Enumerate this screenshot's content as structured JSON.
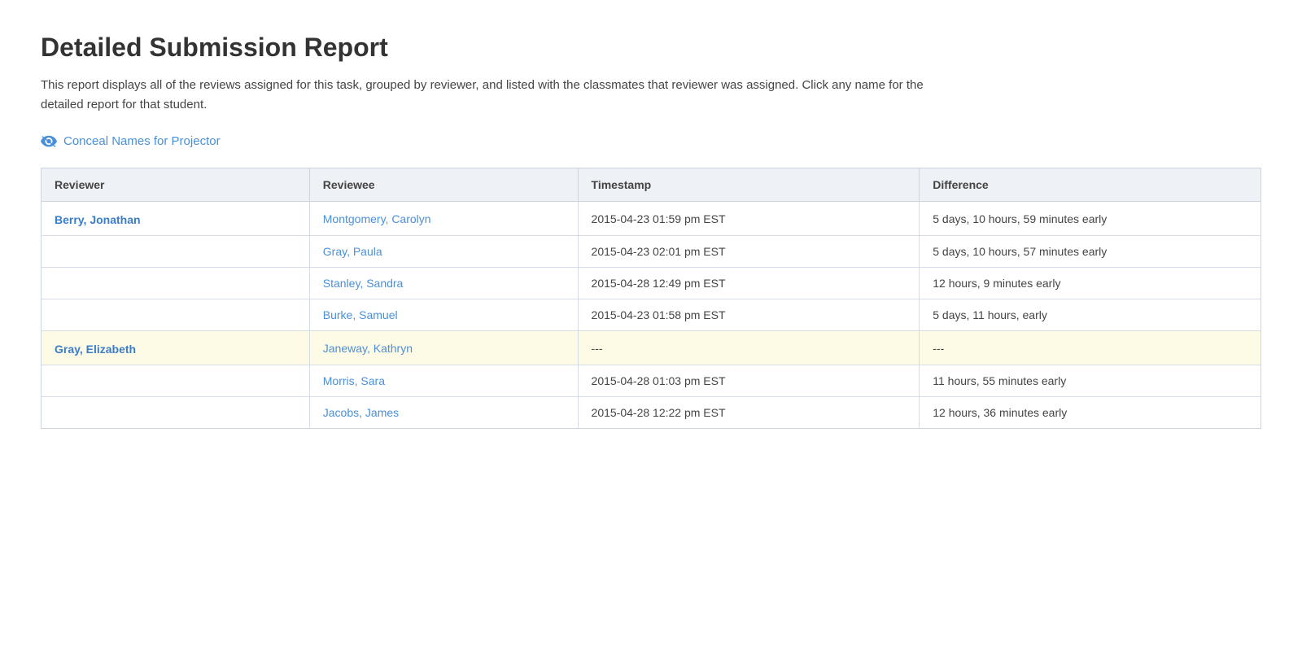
{
  "page": {
    "title": "Detailed Submission Report",
    "description": "This report displays all of the reviews assigned for this task, grouped by reviewer, and listed with the classmates that reviewer was assigned. Click any name for the detailed report for that student.",
    "conceal_label": "Conceal Names for Projector"
  },
  "table": {
    "headers": [
      "Reviewer",
      "Reviewee",
      "Timestamp",
      "Difference"
    ],
    "rows": [
      {
        "reviewer": "Berry, Jonathan",
        "reviewee": "Montgomery, Carolyn",
        "timestamp": "2015-04-23 01:59 pm EST",
        "difference": "5 days, 10 hours, 59 minutes early",
        "highlight": false
      },
      {
        "reviewer": "",
        "reviewee": "Gray, Paula",
        "timestamp": "2015-04-23 02:01 pm EST",
        "difference": "5 days, 10 hours, 57 minutes early",
        "highlight": false
      },
      {
        "reviewer": "",
        "reviewee": "Stanley, Sandra",
        "timestamp": "2015-04-28 12:49 pm EST",
        "difference": "12 hours, 9 minutes early",
        "highlight": false
      },
      {
        "reviewer": "",
        "reviewee": "Burke, Samuel",
        "timestamp": "2015-04-23 01:58 pm EST",
        "difference": "5 days, 11 hours, early",
        "highlight": false
      },
      {
        "reviewer": "Gray, Elizabeth",
        "reviewee": "Janeway, Kathryn",
        "timestamp": "---",
        "difference": "---",
        "highlight": true
      },
      {
        "reviewer": "",
        "reviewee": "Morris, Sara",
        "timestamp": "2015-04-28 01:03 pm EST",
        "difference": "11 hours, 55 minutes early",
        "highlight": false
      },
      {
        "reviewer": "",
        "reviewee": "Jacobs, James",
        "timestamp": "2015-04-28 12:22 pm EST",
        "difference": "12 hours, 36 minutes early",
        "highlight": false
      }
    ]
  }
}
